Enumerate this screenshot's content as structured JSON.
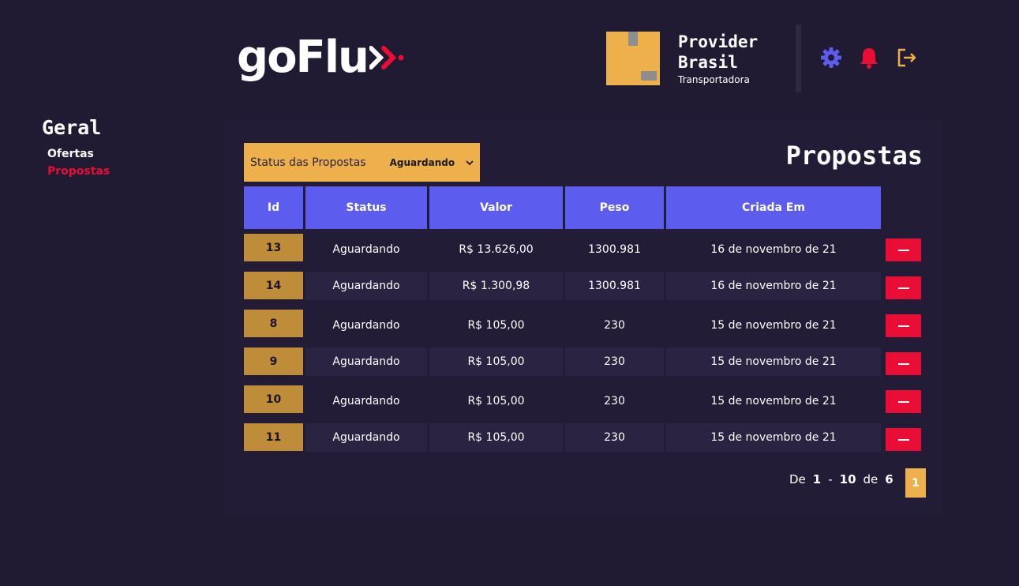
{
  "brand": {
    "logo_text": "goFlu",
    "accent": "#ea0d35"
  },
  "profile": {
    "name": "Provider Brasil",
    "role": "Transportadora"
  },
  "header_icons": [
    "gear-icon",
    "bell-icon",
    "logout-icon"
  ],
  "sidebar": {
    "title": "Geral",
    "items": [
      {
        "label": "Ofertas",
        "active": false
      },
      {
        "label": "Propostas",
        "active": true
      }
    ]
  },
  "filter": {
    "label": "Status das Propostas",
    "selected": "Aguardando"
  },
  "page_title": "Propostas",
  "table": {
    "columns": [
      "Id",
      "Status",
      "Valor",
      "Peso",
      "Criada Em"
    ],
    "rows": [
      {
        "id": "13",
        "status": "Aguardando",
        "valor": "R$ 13.626,00",
        "peso": "1300.981",
        "criada": "16 de novembro de 21"
      },
      {
        "id": "14",
        "status": "Aguardando",
        "valor": "R$ 1.300,98",
        "peso": "1300.981",
        "criada": "16 de novembro de 21"
      },
      {
        "id": "8",
        "status": "Aguardando",
        "valor": "R$ 105,00",
        "peso": "230",
        "criada": "15 de novembro de 21"
      },
      {
        "id": "9",
        "status": "Aguardando",
        "valor": "R$ 105,00",
        "peso": "230",
        "criada": "15 de novembro de 21"
      },
      {
        "id": "10",
        "status": "Aguardando",
        "valor": "R$ 105,00",
        "peso": "230",
        "criada": "15 de novembro de 21"
      },
      {
        "id": "11",
        "status": "Aguardando",
        "valor": "R$ 105,00",
        "peso": "230",
        "criada": "15 de novembro de 21"
      }
    ]
  },
  "pagination": {
    "prefix": "De",
    "from": "1",
    "sep": "-",
    "to": "10",
    "of": "de",
    "total": "6",
    "current_page": "1"
  },
  "colors": {
    "background": "#211a33",
    "header_cell": "#5c5cee",
    "id_cell": "#bf8d3a",
    "delete": "#ea0d35",
    "gold": "#edb04b"
  }
}
